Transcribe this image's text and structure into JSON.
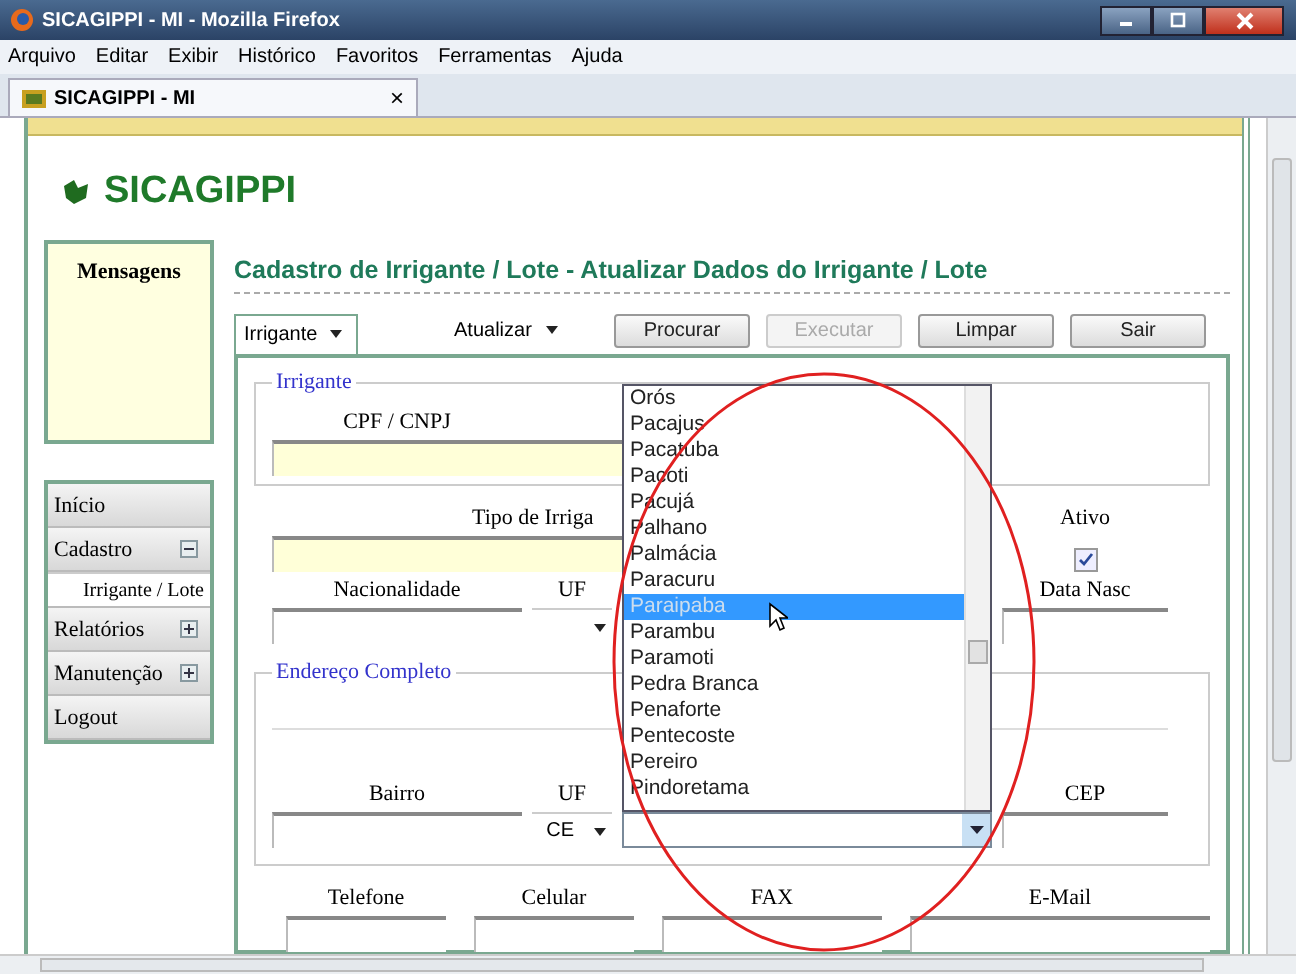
{
  "window": {
    "title": "SICAGIPPI - MI - Mozilla Firefox",
    "menu": [
      "Arquivo",
      "Editar",
      "Exibir",
      "Histórico",
      "Favoritos",
      "Ferramentas",
      "Ajuda"
    ]
  },
  "browser_tab": {
    "title": "SICAGIPPI - MI",
    "close": "×"
  },
  "logo": "SICAGIPPI",
  "messages": {
    "title": "Mensagens"
  },
  "nav": [
    {
      "label": "Início",
      "kind": "link"
    },
    {
      "label": "Cadastro",
      "kind": "group",
      "expanded": true,
      "children": [
        {
          "label": "Irrigante / Lote",
          "selected": true
        }
      ]
    },
    {
      "label": "Relatórios",
      "kind": "group",
      "expanded": false
    },
    {
      "label": "Manutenção",
      "kind": "group",
      "expanded": false
    },
    {
      "label": "Logout",
      "kind": "link"
    }
  ],
  "page_title": "Cadastro de Irrigante / Lote - Atualizar Dados do Irrigante / Lote",
  "toolbar": {
    "section_select": "Irrigante",
    "action_select": "Atualizar",
    "buttons": [
      {
        "label": "Procurar",
        "disabled": false
      },
      {
        "label": "Executar",
        "disabled": true
      },
      {
        "label": "Limpar",
        "disabled": false
      },
      {
        "label": "Sair",
        "disabled": false
      }
    ]
  },
  "irrigante": {
    "legend": "Irrigante",
    "cpf_label": "CPF / CNPJ",
    "tipo_label": "Tipo de Irriga",
    "ativo_label": "Ativo",
    "ativo_checked": true,
    "nacionalidade_label": "Nacionalidade",
    "uf_label": "UF",
    "data_nasc_label": "Data Nasc"
  },
  "endereco": {
    "legend": "Endereço Completo",
    "bairro_label": "Bairro",
    "uf_label": "UF",
    "uf_value": "CE",
    "cep_label": "CEP"
  },
  "contato": {
    "labels": [
      "Telefone",
      "Celular",
      "FAX",
      "E-Mail"
    ]
  },
  "city_dropdown": {
    "items": [
      {
        "label": "Orós",
        "selected": false
      },
      {
        "label": "Pacajus",
        "selected": false
      },
      {
        "label": "Pacatuba",
        "selected": false
      },
      {
        "label": "Pacoti",
        "selected": false
      },
      {
        "label": "Pacujá",
        "selected": false
      },
      {
        "label": "Palhano",
        "selected": false
      },
      {
        "label": "Palmácia",
        "selected": false
      },
      {
        "label": "Paracuru",
        "selected": false
      },
      {
        "label": "Paraipaba",
        "selected": true
      },
      {
        "label": "Parambu",
        "selected": false
      },
      {
        "label": "Paramoti",
        "selected": false
      },
      {
        "label": "Pedra Branca",
        "selected": false
      },
      {
        "label": "Penaforte",
        "selected": false
      },
      {
        "label": "Pentecoste",
        "selected": false
      },
      {
        "label": "Pereiro",
        "selected": false
      },
      {
        "label": "Pindoretama",
        "selected": false
      }
    ]
  }
}
